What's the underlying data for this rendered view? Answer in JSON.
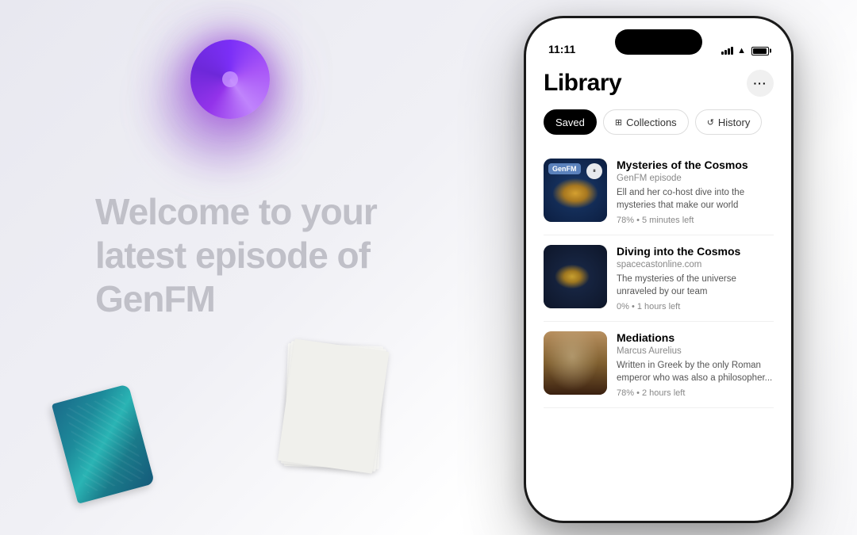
{
  "background": {
    "color": "#f5f5f7"
  },
  "welcome": {
    "line1": "Welcome to your",
    "line2": "latest episode of",
    "line3": "GenFM"
  },
  "status_bar": {
    "time": "11:11",
    "signal_label": "signal",
    "wifi_label": "wifi",
    "battery_label": "battery"
  },
  "app": {
    "title": "Library",
    "more_button_label": "···"
  },
  "filter_tabs": [
    {
      "label": "Saved",
      "active": true,
      "icon": ""
    },
    {
      "label": "Collections",
      "active": false,
      "icon": "⊞"
    },
    {
      "label": "History",
      "active": false,
      "icon": "↺"
    }
  ],
  "episodes": [
    {
      "title": "Mysteries of the Cosmos",
      "source": "GenFM episode",
      "description": "Ell and her co-host dive into the mysteries that make our world",
      "progress": "78% • 5 minutes left",
      "thumb_label": "GenFM",
      "thumb_type": "cosmos1"
    },
    {
      "title": "Diving into the Cosmos",
      "source": "spacecastonline.com",
      "description": "The mysteries of the universe unraveled by our team",
      "progress": "0% • 1 hours left",
      "thumb_label": "",
      "thumb_type": "cosmos2"
    },
    {
      "title": "Mediations",
      "source": "Marcus Aurelius",
      "description": "Written in Greek by the only Roman emperor who was also a philosopher...",
      "progress": "78% • 2 hours left",
      "thumb_label": "",
      "thumb_type": "mediations"
    }
  ]
}
